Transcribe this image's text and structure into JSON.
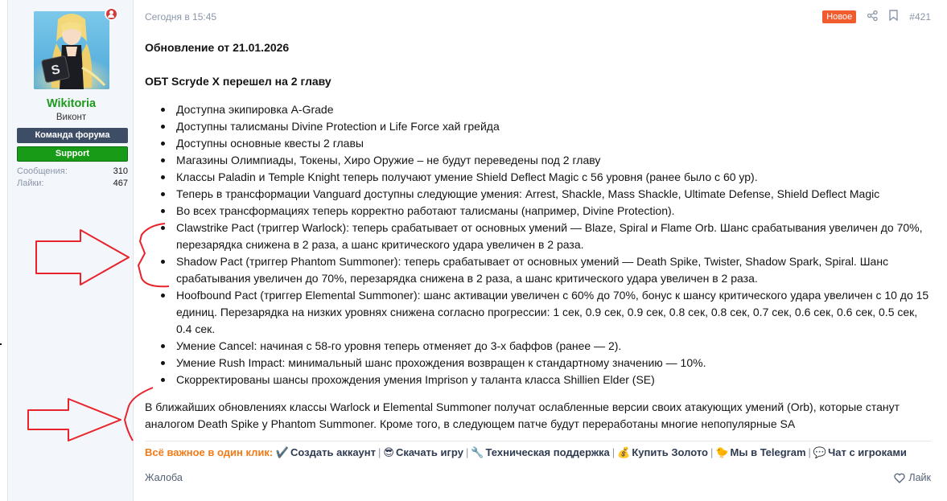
{
  "author": {
    "username": "Wikitoria",
    "title": "Виконт",
    "banners": [
      "Команда форума",
      "Support"
    ],
    "stats": [
      {
        "label": "Сообщения:",
        "value": "310"
      },
      {
        "label": "Лайки:",
        "value": "467"
      }
    ],
    "status_color": "#d23b3b",
    "username_color": "#1d9a1d"
  },
  "post": {
    "date": "Сегодня в 15:45",
    "badge": "Новое",
    "number": "#421",
    "heading": "Обновление от 21.01.2026",
    "subheading": "ОБТ Scryde X перешел на 2 главу",
    "items": [
      "Доступна экипировка A-Grade",
      "Доступны талисманы Divine Protection и Life Force хай грейда",
      "Доступны основные квесты 2 главы",
      "Магазины Олимпиады, Токены, Хиро Оружие – не будут переведены под 2 главу",
      "Классы Paladin и Temple Knight теперь получают умение Shield Deflect Magic с 56 уровня (ранее было с 60 ур).",
      "Теперь в трансформации Vanguard доступны следующие умения: Arrest, Shackle, Mass Shackle, Ultimate Defense, Shield Deflect Magic",
      "Во всех трансформациях теперь корректно работают талисманы (например, Divine Protection).",
      "Clawstrike Pact (триггер Warlock): теперь срабатывает от основных умений — Blaze, Spiral и Flame Orb. Шанс срабатывания увеличен до 70%, перезарядка снижена в 2 раза, а шанс критического удара увеличен в 2 раза.",
      "Shadow Pact (триггер Phantom Summoner): теперь срабатывает от основных умений — Death Spike, Twister, Shadow Spark, Spiral. Шанс срабатывания увеличен до 70%, перезарядка снижена в 2 раза, а шанс критического удара увеличен в 2 раза.",
      "Hoofbound Pact (триггер Elemental Summoner): шанс активации увеличен с 60% до 70%, бонус к шансу критического удара увеличен с 10 до 15 единиц. Перезарядка на низких уровнях снижена согласно прогрессии: 1 сек, 0.9 сек, 0.9 сек, 0.8 сек, 0.8 сек, 0.7 сек, 0.6 сек, 0.6 сек, 0.5 сек, 0.4 сек.",
      "Умение Cancel: начиная с 58-го уровня теперь отменяет до 3-х баффов (ранее — 2).",
      "Умение Rush Impact: минимальный шанс прохождения возвращен к стандартному значению — 10%.",
      "Скорректированы шансы прохождения умения Imprison у таланта класса Shillien Elder (SE)"
    ],
    "outro": "В ближайших обновлениях классы Warlock и Elemental Summoner получат ослабленные версии своих атакующих умений (Orb), которые станут аналогом Death Spike у Phantom Summoner. Кроме того, в следующем патче будут переработаны многие непопулярные SA"
  },
  "links_bar": {
    "lead": "Всё важное в один клик:",
    "links": [
      {
        "emoji": "✔️",
        "label": "Создать аккаунт"
      },
      {
        "emoji": "😎",
        "label": "Скачать игру"
      },
      {
        "emoji": "🔧",
        "label": "Техническая поддержка"
      },
      {
        "emoji": "💰",
        "label": "Купить Золото"
      },
      {
        "emoji": "🐤",
        "label": "Мы в Telegram"
      },
      {
        "emoji": "💬",
        "label": "Чат с игроками"
      }
    ]
  },
  "footer": {
    "report": "Жалоба",
    "like": "Лайк"
  },
  "colors": {
    "badge": "#f15c2f",
    "lead": "#f07b19",
    "annotation_red": "#e8232b"
  }
}
